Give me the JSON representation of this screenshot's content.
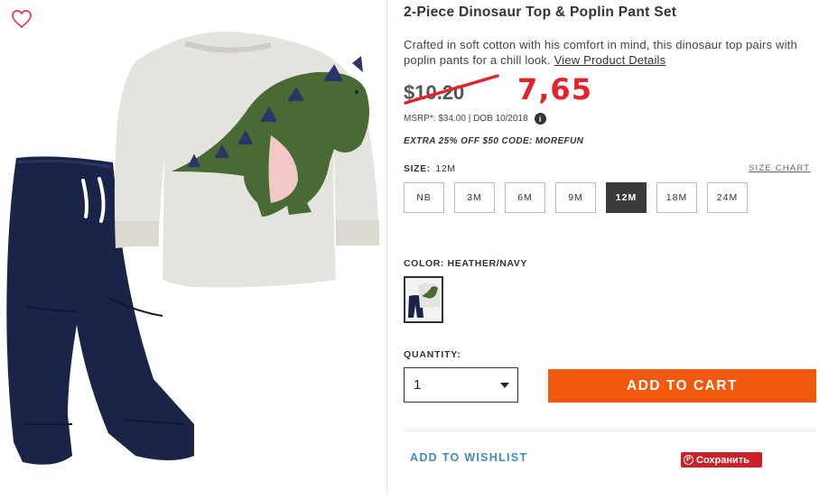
{
  "product": {
    "title": "2-Piece Dinosaur Top & Poplin Pant Set",
    "description": "Crafted in soft cotton with his comfort in mind, this dinosaur top pairs with poplin pants for a chill look.",
    "details_link": "View Product Details"
  },
  "price": {
    "old": "$10.20",
    "new": "7,65",
    "msrp": "MSRP*: $34.00 | DOB 10/2018",
    "info_icon": "i",
    "promo": "EXTRA 25% OFF $50 CODE: MOREFUN"
  },
  "size": {
    "label": "SIZE:",
    "selected": "12M",
    "chart_link": "SIZE CHART",
    "options": [
      "NB",
      "3M",
      "6M",
      "9M",
      "12M",
      "18M",
      "24M"
    ]
  },
  "color": {
    "label": "COLOR: HEATHER/NAVY"
  },
  "quantity": {
    "label": "QUANTITY:",
    "value": "1"
  },
  "actions": {
    "add_to_cart": "ADD TO CART",
    "wishlist": "ADD TO WISHLIST",
    "pin": "Сохранить",
    "pin_icon": "P"
  },
  "colors": {
    "accent": "#f15a0d",
    "new_price": "#e3232b",
    "link_blue": "#3a8dc5",
    "pinterest": "#cb2027"
  },
  "icons": [
    "heart-icon",
    "info-icon",
    "chevron-down-icon",
    "pinterest-icon"
  ]
}
